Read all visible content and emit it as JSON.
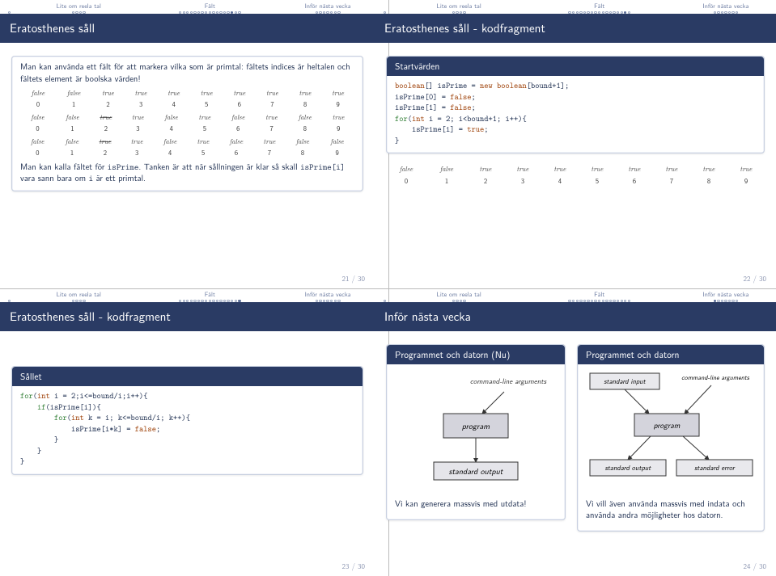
{
  "nav": {
    "secA": "",
    "secB": "Lite om reela tal",
    "secC": "Fält",
    "secD": "Inför nästa vecka"
  },
  "slide21": {
    "title": "Eratosthenes såll",
    "para1a": "Man kan använda ett fält för att markera vilka som är primtal: fältets indices är heltalen och fältets element är boolska värden!",
    "para2a": "Man kan kalla fältet för ",
    "para2b": "isPrime",
    "para2c": ". Tanken är att när sållningen är klar så skall ",
    "para2d": "isPrime[i]",
    "para2e": " vara sann bara om ",
    "para2f": "i",
    "para2g": " är ett primtal.",
    "footer": "21 / 30",
    "row1": [
      "false",
      "false",
      "true",
      "true",
      "true",
      "true",
      "true",
      "true",
      "true",
      "true"
    ],
    "row2": [
      "false",
      "false",
      "true",
      "true",
      "false",
      "true",
      "false",
      "true",
      "false",
      "true"
    ],
    "row3": [
      "false",
      "false",
      "true",
      "true",
      "false",
      "true",
      "false",
      "true",
      "false",
      "false"
    ],
    "idx": [
      "0",
      "1",
      "2",
      "3",
      "4",
      "5",
      "6",
      "7",
      "8",
      "9"
    ]
  },
  "slide22": {
    "title": "Eratosthenes såll - kodfragment",
    "blockTitle": "Startvärden",
    "footer": "22 / 30",
    "row": [
      "false",
      "false",
      "true",
      "true",
      "true",
      "true",
      "true",
      "true",
      "true",
      "true"
    ],
    "idx": [
      "0",
      "1",
      "2",
      "3",
      "4",
      "5",
      "6",
      "7",
      "8",
      "9"
    ]
  },
  "slide23": {
    "title": "Eratosthenes såll - kodfragment",
    "blockTitle": "Sållet",
    "footer": "23 / 30"
  },
  "slide24": {
    "title": "Inför nästa vecka",
    "block1Title": "Programmet och datorn (Nu)",
    "block1Text": "Vi kan generera massvis med utdata!",
    "block2Title": "Programmet och datorn",
    "block2Text": "Vi vill även använda massvis med indata och använda andra möjligheter hos datorn.",
    "footer": "24 / 30",
    "diag": {
      "cla": "command-line arguments",
      "prog": "program",
      "stdout": "standard output",
      "stdin": "standard input",
      "stderr": "standard error"
    }
  }
}
